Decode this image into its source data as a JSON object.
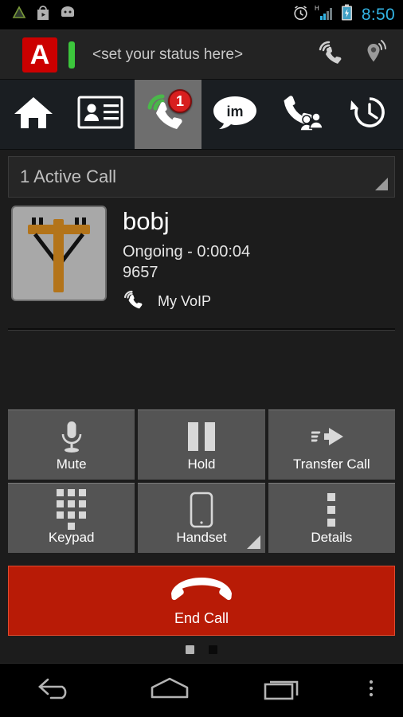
{
  "status_bar": {
    "left_icons": [
      {
        "name": "notification-triangle-icon"
      },
      {
        "name": "play-store-icon"
      },
      {
        "name": "android-robot-icon"
      }
    ],
    "right_icons": [
      {
        "name": "alarm-clock-icon"
      },
      {
        "name": "signal-h-icon",
        "label": "H"
      },
      {
        "name": "battery-charging-icon"
      }
    ],
    "time": "8:50",
    "time_color": "#33b5e5"
  },
  "app_header": {
    "logo_letter": "A",
    "logo_color": "#cc0000",
    "presence_color": "#3cc63c",
    "status_text": "<set your status here>",
    "icons": [
      {
        "name": "voip-handset-icon"
      },
      {
        "name": "location-pin-signal-icon"
      }
    ]
  },
  "tabs": [
    {
      "name": "tab-home",
      "icon": "home-icon",
      "selected": false,
      "badge": null
    },
    {
      "name": "tab-contacts",
      "icon": "contact-card-icon",
      "selected": false,
      "badge": null
    },
    {
      "name": "tab-active-calls",
      "icon": "voip-handset-icon",
      "selected": true,
      "badge": "1"
    },
    {
      "name": "tab-im",
      "icon": "im-chat-bubble-icon",
      "selected": false,
      "badge": null,
      "glyph": "im"
    },
    {
      "name": "tab-conference",
      "icon": "conference-call-icon",
      "selected": false,
      "badge": null
    },
    {
      "name": "tab-history",
      "icon": "call-history-clock-icon",
      "selected": false,
      "badge": null
    }
  ],
  "section": {
    "title": "1 Active Call"
  },
  "call": {
    "avatar_icon": "telephone-pole-avatar",
    "name": "bobj",
    "state": "Ongoing - 0:00:04",
    "number": "9657",
    "account_icon": "voip-handset-icon",
    "account": "My VoIP"
  },
  "controls": {
    "rows": [
      [
        {
          "name": "mute-button",
          "label": "Mute",
          "icon": "microphone-icon",
          "has_corner": false
        },
        {
          "name": "hold-button",
          "label": "Hold",
          "icon": "pause-icon",
          "has_corner": false
        },
        {
          "name": "transfer-call-button",
          "label": "Transfer Call",
          "icon": "transfer-arrow-icon",
          "has_corner": false
        }
      ],
      [
        {
          "name": "keypad-button",
          "label": "Keypad",
          "icon": "dialpad-icon",
          "has_corner": false
        },
        {
          "name": "handset-button",
          "label": "Handset",
          "icon": "handset-device-icon",
          "has_corner": true
        },
        {
          "name": "details-button",
          "label": "Details",
          "icon": "overflow-dots-icon",
          "has_corner": false
        }
      ]
    ]
  },
  "end_call": {
    "label": "End Call",
    "icon": "hangup-handset-icon",
    "color": "#b81b06"
  },
  "pager": {
    "total": 2,
    "active_index": 0
  },
  "nav_bar": {
    "buttons": [
      {
        "name": "nav-back-button",
        "icon": "back-arrow-icon"
      },
      {
        "name": "nav-home-button",
        "icon": "home-pentagon-icon"
      },
      {
        "name": "nav-recents-button",
        "icon": "recents-icon"
      },
      {
        "name": "nav-menu-button",
        "icon": "overflow-dots-icon"
      }
    ]
  }
}
